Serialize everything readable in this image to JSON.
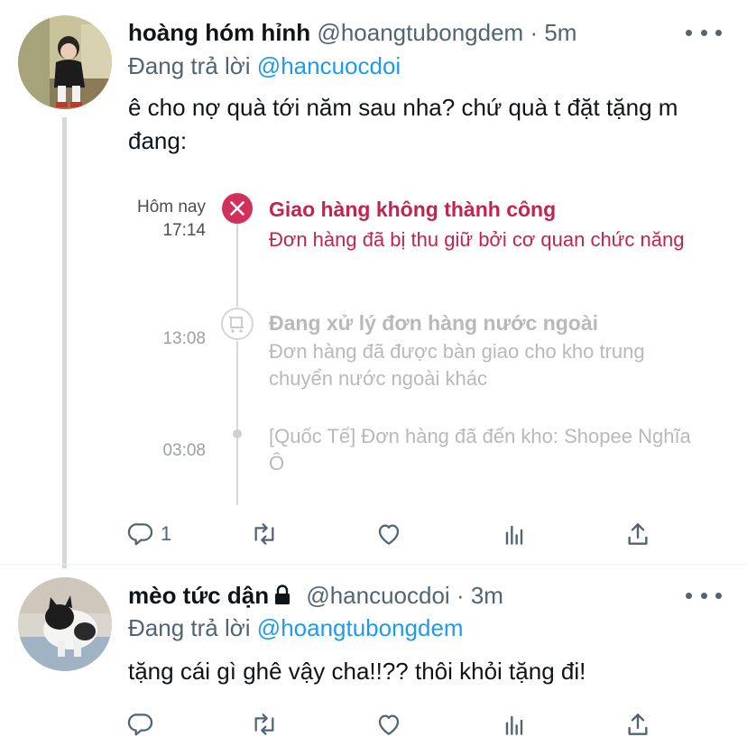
{
  "tweet1": {
    "display_name": "hoàng hóm hỉnh",
    "handle": "@hoangtubongdem",
    "time": "· 5m",
    "reply_prefix": "Đang trả lời",
    "reply_to": "@hancuocdoi",
    "text": "ê cho nợ quà tới năm sau nha? chứ quà t đặt tặng m đang:",
    "reply_count": "1",
    "shipping": {
      "accent": "#d0305a",
      "events": [
        {
          "day": "Hôm nay",
          "time": "17:14",
          "title": "Giao hàng không thành công",
          "desc": "Đơn hàng đã bị thu giữ bởi cơ quan chức năng"
        },
        {
          "time": "13:08",
          "title": "Đang xử lý đơn hàng nước ngoài",
          "desc": "Đơn hàng đã được bàn giao cho kho trung chuyển nước ngoài khác"
        },
        {
          "time": "03:08",
          "desc": "[Quốc Tế] Đơn hàng đã đến kho: Shopee Nghĩa Ô"
        }
      ]
    }
  },
  "tweet2": {
    "display_name": "mèo tức dận",
    "handle": "@hancuocdoi",
    "time": "· 3m",
    "reply_prefix": "Đang trả lời",
    "reply_to": "@hoangtubongdem",
    "text": "tặng cái gì ghê vậy cha!!?? thôi khỏi tặng đi!"
  },
  "icons": [
    "more-icon",
    "reply-icon",
    "retweet-icon",
    "like-icon",
    "analytics-icon",
    "share-icon",
    "lock-icon",
    "close-x-icon",
    "package-icon"
  ],
  "colors": {
    "link": "#1d9bf0",
    "muted": "#536471",
    "thread_line": "#cfd9de"
  }
}
